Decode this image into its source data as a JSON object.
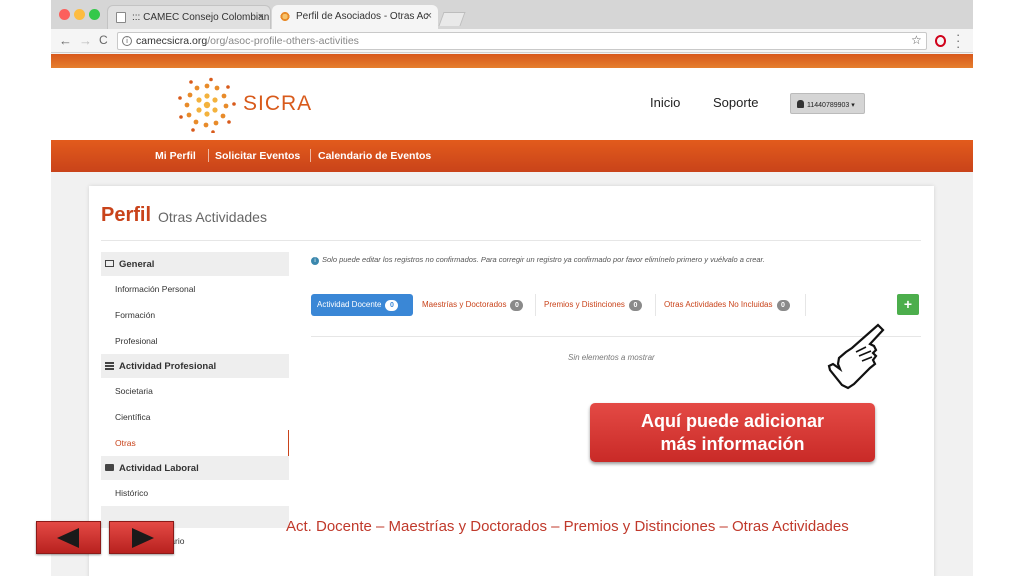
{
  "browser": {
    "tabs": [
      {
        "title": "::: CAMEC Consejo Colombian",
        "close": "×"
      },
      {
        "title": "Perfil de Asociados - Otras Ac",
        "close": "×"
      }
    ],
    "url_host": "camecsicra.org",
    "url_path": "/org/asoc-profile-others-activities",
    "back": "←",
    "forward": "→",
    "reload": "C",
    "star": "☆",
    "info": "i"
  },
  "site": {
    "logo_text": "SICRA",
    "top_links": [
      "Inicio",
      "Soporte"
    ],
    "user_label": "11440789903 ▾",
    "nav": [
      "Mi Perfil",
      "Solicitar Eventos",
      "Calendario de Eventos"
    ]
  },
  "page": {
    "title": "Perfil",
    "subtitle": "Otras Actividades",
    "alert_icon": "i",
    "alert": "Solo puede editar los registros no confirmados. Para corregir un registro ya confirmado por favor elimínelo primero y vuélvalo a crear.",
    "empty": "Sin elementos a mostrar",
    "add_label": "+"
  },
  "sidebar": {
    "sections": [
      {
        "title": "General",
        "icon": "card-icon",
        "items": [
          "Información Personal",
          "Formación",
          "Profesional"
        ]
      },
      {
        "title": "Actividad Profesional",
        "icon": "list-icon",
        "items": [
          "Societaria",
          "Científica",
          "Otras"
        ]
      },
      {
        "title": "Actividad Laboral",
        "icon": "briefcase-icon",
        "items": [
          "Histórico"
        ]
      }
    ],
    "extra_item": "Cuenta de usuario",
    "active_item": "Otras"
  },
  "activity_tabs": [
    {
      "label": "Actividad Docente",
      "count": "0",
      "active": true
    },
    {
      "label": "Maestrías y Doctorados",
      "count": "0",
      "active": false
    },
    {
      "label": "Premios y Distinciones",
      "count": "0",
      "active": false
    },
    {
      "label": "Otras Actividades No Incluidas",
      "count": "0",
      "active": false
    }
  ],
  "slide": {
    "callout_line1": "Aquí puede adicionar",
    "callout_line2": "más información",
    "caption": "Act. Docente – Maestrías y Doctorados – Premios y Distinciones – Otras Actividades"
  },
  "colors": {
    "brand_orange": "#d85a1b",
    "callout_red": "#d43a36",
    "tab_blue": "#3a87d6",
    "add_green": "#4cae4c"
  }
}
